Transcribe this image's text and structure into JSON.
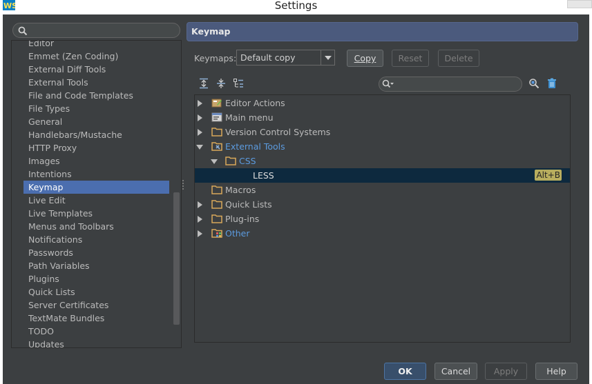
{
  "window": {
    "title": "Settings",
    "app_icon": "webstorm-logo-icon"
  },
  "sidebar": {
    "search": {
      "value": "",
      "placeholder": ""
    },
    "items": [
      {
        "label": "Editor"
      },
      {
        "label": "Emmet (Zen Coding)"
      },
      {
        "label": "External Diff Tools"
      },
      {
        "label": "External Tools"
      },
      {
        "label": "File and Code Templates"
      },
      {
        "label": "File Types"
      },
      {
        "label": "General"
      },
      {
        "label": "Handlebars/Mustache"
      },
      {
        "label": "HTTP Proxy"
      },
      {
        "label": "Images"
      },
      {
        "label": "Intentions"
      },
      {
        "label": "Keymap",
        "selected": true
      },
      {
        "label": "Live Edit"
      },
      {
        "label": "Live Templates"
      },
      {
        "label": "Menus and Toolbars"
      },
      {
        "label": "Notifications"
      },
      {
        "label": "Passwords"
      },
      {
        "label": "Path Variables"
      },
      {
        "label": "Plugins"
      },
      {
        "label": "Quick Lists"
      },
      {
        "label": "Server Certificates"
      },
      {
        "label": "TextMate Bundles"
      },
      {
        "label": "TODO"
      },
      {
        "label": "Updates"
      }
    ]
  },
  "panel": {
    "title": "Keymap",
    "keymaps_label": "Keymaps:",
    "keymap_selected": "Default copy",
    "buttons": {
      "copy": "Copy",
      "reset": "Reset",
      "delete": "Delete"
    },
    "toolbar_icons": [
      "expand-all-icon",
      "collapse-all-icon",
      "group-icon",
      "find-shortcut-icon",
      "clear-icon"
    ],
    "filter": {
      "value": "",
      "placeholder": ""
    },
    "tree": [
      {
        "label": "Editor Actions",
        "icon": "editor-actions-icon",
        "expanded": false
      },
      {
        "label": "Main menu",
        "icon": "main-menu-icon",
        "expanded": false
      },
      {
        "label": "Version Control Systems",
        "icon": "folder-icon",
        "expanded": false
      },
      {
        "label": "External Tools",
        "icon": "external-tools-icon",
        "expanded": true,
        "modified": true
      },
      {
        "label": "CSS",
        "icon": "folder-icon",
        "expanded": true,
        "modified": true
      },
      {
        "label": "LESS",
        "shortcut": "Alt+B",
        "selected": true
      },
      {
        "label": "Macros",
        "icon": "folder-icon"
      },
      {
        "label": "Quick Lists",
        "icon": "folder-icon",
        "expanded": false
      },
      {
        "label": "Plug-ins",
        "icon": "folder-icon",
        "expanded": false
      },
      {
        "label": "Other",
        "icon": "other-icon",
        "expanded": false,
        "modified": true
      }
    ]
  },
  "footer": {
    "ok": "OK",
    "cancel": "Cancel",
    "apply": "Apply",
    "help": "Help"
  },
  "colors": {
    "background": "#3c3f41",
    "selection": "#4b6eaf",
    "tree_selection": "#0d293e",
    "modified_text": "#5c9bdf",
    "shortcut_badge": "#b8ad5e"
  }
}
